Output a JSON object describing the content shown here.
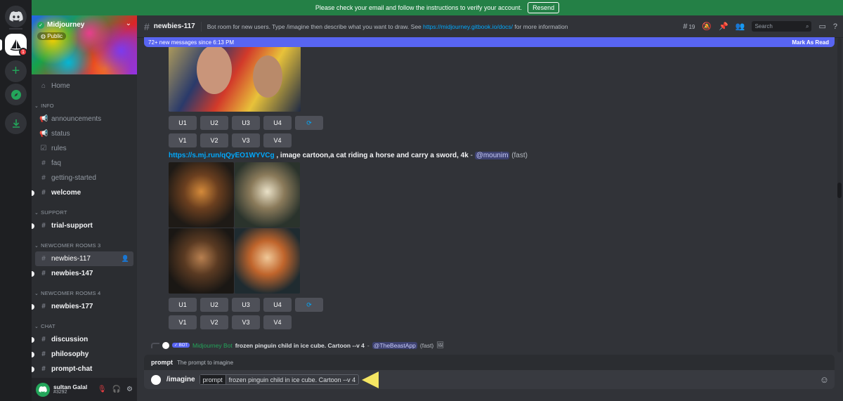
{
  "notice": {
    "text": "Please check your email and follow the instructions to verify your account.",
    "resend": "Resend"
  },
  "rail": {
    "badge": "1"
  },
  "server": {
    "name": "Midjourney",
    "visibility": "Public"
  },
  "sidebar": {
    "home": "Home",
    "info_cat": "INFO",
    "info": [
      "announcements",
      "status",
      "rules",
      "faq",
      "getting-started",
      "welcome"
    ],
    "support_cat": "SUPPORT",
    "support": [
      "trial-support"
    ],
    "newcomer3_cat": "NEWCOMER ROOMS 3",
    "newcomer3": [
      "newbies-117",
      "newbies-147"
    ],
    "newcomer4_cat": "NEWCOMER ROOMS 4",
    "newcomer4": [
      "newbies-177"
    ],
    "chat_cat": "CHAT",
    "chat": [
      "discussion",
      "philosophy",
      "prompt-chat"
    ]
  },
  "user": {
    "name": "sultan Galal",
    "tag": "#3292"
  },
  "header": {
    "channel": "newbies-117",
    "topic_pre": "Bot room for new users. Type /imagine then describe what you want to draw. See ",
    "topic_link": "https://midjourney.gitbook.io/docs/",
    "topic_post": " for more information",
    "threads_count": "19",
    "search_placeholder": "Search"
  },
  "newbar": {
    "text": "72+ new messages since 6:13 PM",
    "mark": "Mark As Read"
  },
  "buttons": {
    "u": [
      "U1",
      "U2",
      "U3",
      "U4"
    ],
    "v": [
      "V1",
      "V2",
      "V3",
      "V4"
    ]
  },
  "message2": {
    "link": "https://s.mj.run/qQyEO1WYVCg",
    "text": " , image cartoon,a cat riding a horse and carry a sword, 4k",
    "sep": " - ",
    "mention": "@mounim",
    "speed": "(fast)"
  },
  "reply": {
    "bot_tag": "✓ BOT",
    "author": "Midjourney Bot",
    "text": "frozen pinguin child in ice cube. Cartoon --v 4",
    "sep": " - ",
    "mention": "@TheBeastApp",
    "speed": "(fast)"
  },
  "hint": {
    "key": "prompt",
    "desc": "The prompt to imagine"
  },
  "input": {
    "command": "/imagine",
    "option": "prompt",
    "value": "frozen pinguin child in ice cube. Cartoon --v 4"
  },
  "colors": {
    "accent": "#5865f2",
    "notice": "#248046",
    "link": "#00a8fc",
    "highlight_arrow": "#f5e663"
  }
}
